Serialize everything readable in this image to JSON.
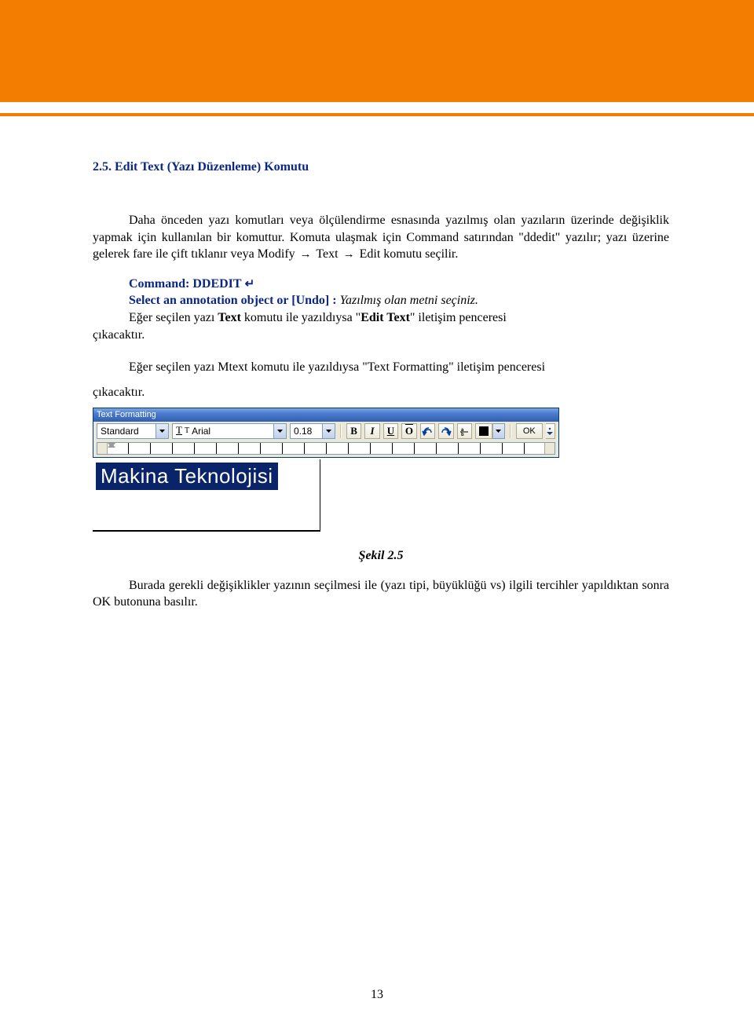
{
  "section": {
    "heading": "2.5. Edit Text (Yazı Düzenleme) Komutu",
    "para1_pre": "Daha önceden yazı komutları veya ölçülendirme esnasında yazılmış olan yazıların üzerinde değişiklik yapmak için kullanılan bir komuttur. Komuta ulaşmak için Command satırından \"ddedit\" yazılır; yazı üzerine gelerek fare ile çift tıklanır veya Modify ",
    "para1_mid1": " Text ",
    "para1_post": " Edit komutu seçilir.",
    "cmd": {
      "line1": "Command: DDEDIT",
      "enter": "↵",
      "line2_bold": "Select an annotation object or [Undo] :",
      "line2_italic": "  Yazılmış olan metni seçiniz.",
      "result_pre": "Eğer seçilen yazı ",
      "text_bold": "Text",
      "result_mid": " komutu ile yazıldıysa \"",
      "edit_bold": "Edit Text",
      "result_post": "\" iletişim  penceresi ",
      "result_end": "çıkacaktır."
    },
    "para3_pre": "Eğer seçilen yazı Mtext komutu ile yazıldıysa \"Text Formatting\" iletişim penceresi ",
    "para3_end": "çıkacaktır."
  },
  "toolbar": {
    "title": "Text Formatting",
    "style_value": "Standard",
    "font_value": "Arial",
    "height_value": "0.18",
    "b": "B",
    "i": "I",
    "u": "U",
    "o": "O",
    "ok": "OK"
  },
  "editor": {
    "selected_text": "Makina Teknolojisi"
  },
  "figure_caption": "Şekil 2.5",
  "closing_para_pre": "Burada gerekli  değişiklikler yazının seçilmesi ile (yazı tipi, büyüklüğü vs) ilgili tercihler yapıldıktan sonra OK butonuna basılır.",
  "page_number": "13"
}
